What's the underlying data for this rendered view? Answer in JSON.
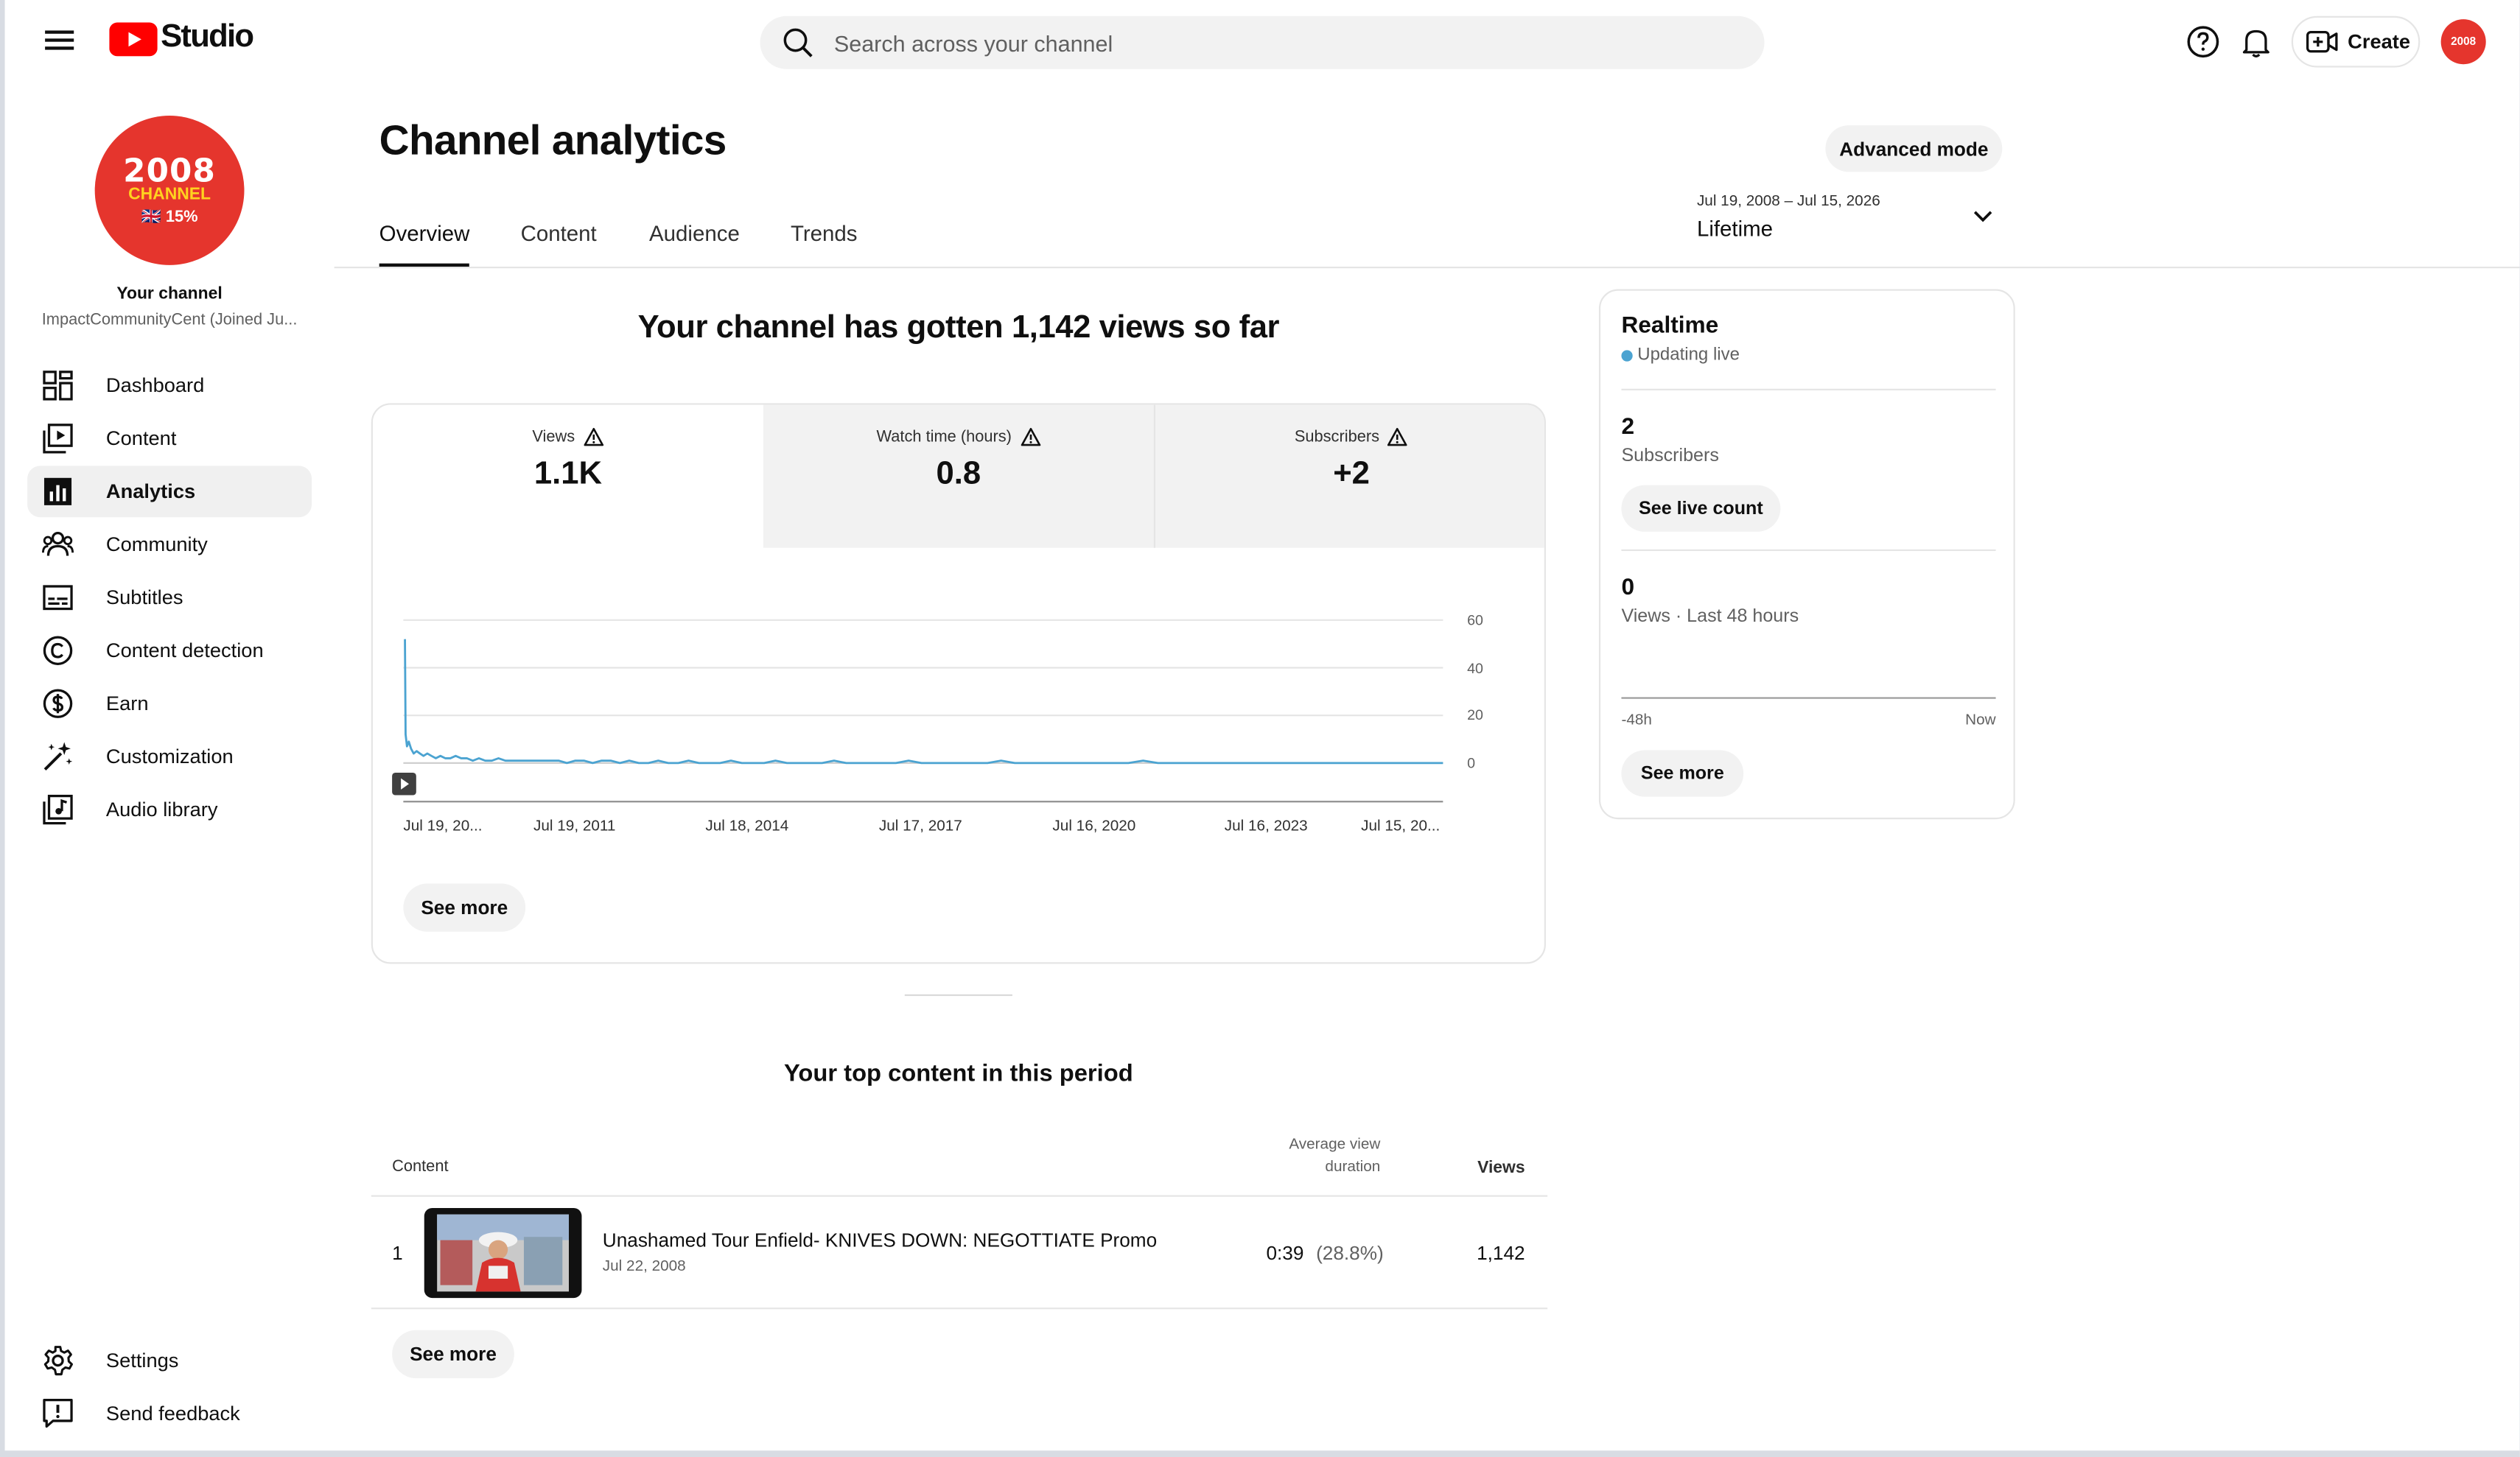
{
  "topbar": {
    "logo_text": "Studio",
    "search_placeholder": "Search across your channel",
    "create_label": "Create",
    "avatar_text": "2008"
  },
  "channel": {
    "avatar_line1": "2008",
    "avatar_line2": "CHANNEL",
    "avatar_line3": "🇬🇧 15%",
    "title": "Your channel",
    "name": "ImpactCommunityCent (Joined Ju..."
  },
  "sidebar": {
    "items": [
      {
        "label": "Dashboard",
        "icon": "dashboard-icon"
      },
      {
        "label": "Content",
        "icon": "content-icon"
      },
      {
        "label": "Analytics",
        "icon": "analytics-icon",
        "active": true
      },
      {
        "label": "Community",
        "icon": "community-icon"
      },
      {
        "label": "Subtitles",
        "icon": "subtitles-icon"
      },
      {
        "label": "Content detection",
        "icon": "copyright-icon"
      },
      {
        "label": "Earn",
        "icon": "dollar-icon"
      },
      {
        "label": "Customization",
        "icon": "magic-wand-icon"
      },
      {
        "label": "Audio library",
        "icon": "audio-library-icon"
      }
    ],
    "bottom": [
      {
        "label": "Settings",
        "icon": "gear-icon"
      },
      {
        "label": "Send feedback",
        "icon": "feedback-icon"
      }
    ]
  },
  "page": {
    "title": "Channel analytics",
    "advanced_mode": "Advanced mode",
    "tabs": [
      "Overview",
      "Content",
      "Audience",
      "Trends"
    ],
    "date_range": "Jul 19, 2008 – Jul 15, 2026",
    "date_preset": "Lifetime"
  },
  "overview": {
    "headline": "Your channel has gotten 1,142 views so far",
    "metrics": [
      {
        "label": "Views",
        "value": "1.1K"
      },
      {
        "label": "Watch time (hours)",
        "value": "0.8"
      },
      {
        "label": "Subscribers",
        "value": "+2"
      }
    ],
    "see_more": "See more"
  },
  "chart_data": {
    "type": "line",
    "series": [
      {
        "values": [
          52,
          12,
          7,
          9,
          6,
          4,
          5,
          4,
          3,
          4,
          3,
          2,
          3,
          2,
          2,
          3,
          2,
          2,
          1,
          2,
          1,
          1,
          2,
          1,
          1,
          1,
          1,
          1,
          1,
          1,
          1,
          0,
          1,
          1,
          0,
          1,
          1,
          0,
          1,
          0,
          0,
          1,
          0,
          0,
          1,
          0,
          0,
          0,
          1,
          0,
          0,
          0,
          1,
          0,
          0,
          0,
          0,
          1,
          0,
          0,
          0,
          0,
          0,
          1,
          0,
          0,
          0,
          0,
          0,
          0,
          1,
          0,
          0,
          0,
          0,
          0,
          0,
          0,
          0,
          0,
          1,
          0,
          0,
          0,
          0,
          0,
          0,
          0,
          0,
          0,
          0,
          0,
          0,
          0,
          0,
          0,
          0,
          0,
          0,
          0
        ]
      }
    ],
    "x_ticks": [
      "Jul 19, 20...",
      "Jul 19, 2011",
      "Jul 18, 2014",
      "Jul 17, 2017",
      "Jul 16, 2020",
      "Jul 16, 2023",
      "Jul 15, 20..."
    ],
    "y_ticks": [
      "60",
      "40",
      "20",
      "0"
    ],
    "ylim": [
      0,
      60
    ],
    "grid": true,
    "color": "#4ba3d1"
  },
  "top_content": {
    "title": "Your top content in this period",
    "col_content": "Content",
    "col_avd": "Average view duration",
    "col_views": "Views",
    "rows": [
      {
        "rank": "1",
        "title": "Unashamed Tour Enfield- KNIVES DOWN: NEGOTTIATE Promo",
        "date": "Jul 22, 2008",
        "avd": "0:39",
        "avd_pct": "(28.8%)",
        "views": "1,142"
      }
    ],
    "see_more": "See more"
  },
  "realtime": {
    "title": "Realtime",
    "status": "Updating live",
    "subscribers_value": "2",
    "subscribers_label": "Subscribers",
    "live_count_btn": "See live count",
    "views_value": "0",
    "views_label": "Views · Last 48 hours",
    "axis_left": "-48h",
    "axis_right": "Now",
    "see_more": "See more"
  }
}
